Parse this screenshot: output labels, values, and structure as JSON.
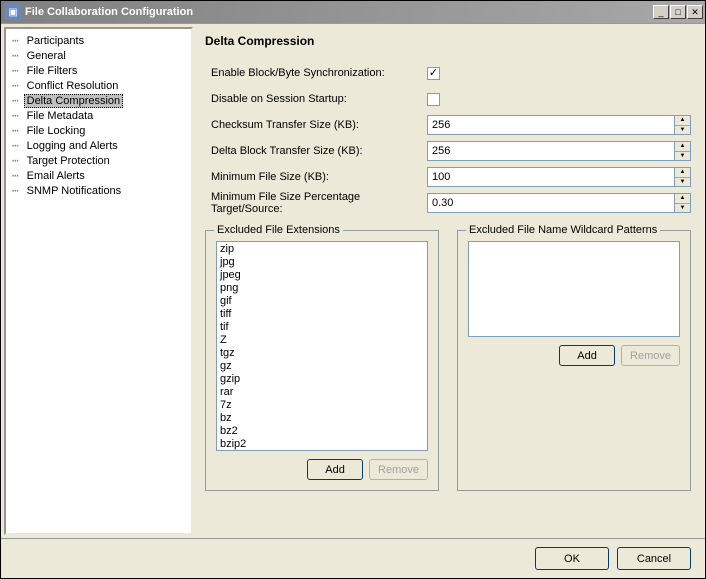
{
  "window": {
    "title": "File Collaboration Configuration"
  },
  "sidebar": {
    "items": [
      {
        "label": "Participants",
        "selected": false
      },
      {
        "label": "General",
        "selected": false
      },
      {
        "label": "File Filters",
        "selected": false
      },
      {
        "label": "Conflict Resolution",
        "selected": false
      },
      {
        "label": "Delta Compression",
        "selected": true
      },
      {
        "label": "File Metadata",
        "selected": false
      },
      {
        "label": "File Locking",
        "selected": false
      },
      {
        "label": "Logging and Alerts",
        "selected": false
      },
      {
        "label": "Target Protection",
        "selected": false
      },
      {
        "label": "Email Alerts",
        "selected": false
      },
      {
        "label": "SNMP Notifications",
        "selected": false
      }
    ]
  },
  "main": {
    "title": "Delta Compression",
    "fields": {
      "enable_sync_label": "Enable Block/Byte Synchronization:",
      "enable_sync_checked": "✓",
      "disable_startup_label": "Disable on Session Startup:",
      "disable_startup_checked": "",
      "checksum_label": "Checksum Transfer Size (KB):",
      "checksum_value": "256",
      "delta_block_label": "Delta Block Transfer Size (KB):",
      "delta_block_value": "256",
      "min_size_label": "Minimum File Size (KB):",
      "min_size_value": "100",
      "min_pct_label": "Minimum File Size Percentage Target/Source:",
      "min_pct_value": "0.30"
    },
    "ext_group": {
      "title": "Excluded File Extensions",
      "items": [
        "zip",
        "jpg",
        "jpeg",
        "png",
        "gif",
        "tiff",
        "tif",
        "Z",
        "tgz",
        "gz",
        "gzip",
        "rar",
        "7z",
        "bz",
        "bz2",
        "bzip2"
      ],
      "add_label": "Add",
      "remove_label": "Remove"
    },
    "wild_group": {
      "title": "Excluded File Name Wildcard Patterns",
      "items": [],
      "add_label": "Add",
      "remove_label": "Remove"
    }
  },
  "footer": {
    "ok_label": "OK",
    "cancel_label": "Cancel"
  }
}
